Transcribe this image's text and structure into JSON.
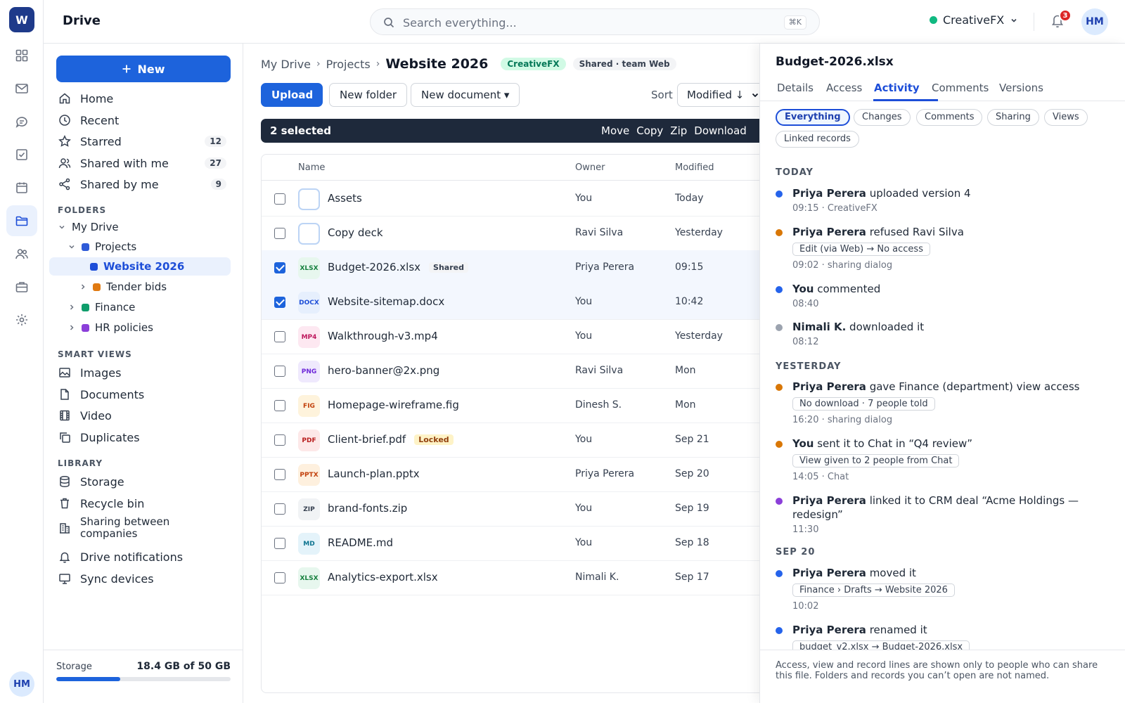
{
  "app": {
    "logo_letter": "W",
    "title": "Drive",
    "user_initials": "HM"
  },
  "search": {
    "placeholder": "Search everything...",
    "shortcut": "⌘K"
  },
  "header": {
    "company": "CreativeFX",
    "notification_count": "3",
    "avatar": "HM"
  },
  "rail": {
    "icons": [
      "grid-icon",
      "mail-icon",
      "chat-icon",
      "task-icon",
      "calendar-icon",
      "folder-icon",
      "people-icon",
      "briefcase-icon",
      "gear-icon"
    ],
    "active": "folder-icon"
  },
  "sidebar": {
    "new_label": "New",
    "nav": [
      {
        "label": "Home",
        "icon": "home-icon"
      },
      {
        "label": "Recent",
        "icon": "clock-icon"
      },
      {
        "label": "Starred",
        "icon": "star-icon",
        "count": "12"
      },
      {
        "label": "Shared with me",
        "icon": "people-icon",
        "count": "27"
      },
      {
        "label": "Shared by me",
        "icon": "share-icon",
        "count": "9"
      }
    ],
    "folders_label": "FOLDERS",
    "tree": [
      {
        "label": "My Drive"
      },
      {
        "label": "Projects",
        "color": "#2f5bd8"
      },
      {
        "label": "Website 2026",
        "color": "#1d4ed8"
      },
      {
        "label": "Tender bids",
        "color": "#e07a12"
      },
      {
        "label": "Finance",
        "color": "#0f9d6b"
      },
      {
        "label": "HR policies",
        "color": "#8b3fd9"
      }
    ],
    "smart_label": "SMART VIEWS",
    "smart": [
      {
        "label": "Images",
        "icon": "image-icon"
      },
      {
        "label": "Documents",
        "icon": "document-icon"
      },
      {
        "label": "Video",
        "icon": "film-icon"
      },
      {
        "label": "Duplicates",
        "icon": "copy-icon"
      }
    ],
    "library_label": "LIBRARY",
    "library": [
      {
        "label": "Storage",
        "icon": "database-icon"
      },
      {
        "label": "Recycle bin",
        "icon": "trash-icon"
      },
      {
        "label": "Sharing between",
        "label2": "companies",
        "icon": "building-icon"
      },
      {
        "label": "Drive notifications",
        "icon": "bell-icon"
      },
      {
        "label": "Sync devices",
        "icon": "monitor-icon"
      }
    ],
    "storage": {
      "label": "Storage",
      "value": "18.4 GB of 50 GB",
      "fraction": 0.368
    }
  },
  "main": {
    "breadcrumb": [
      "My Drive",
      "Projects"
    ],
    "current": "Website 2026",
    "company_pill": "CreativeFX",
    "shared_pill": "Shared · team Web",
    "upload": "Upload",
    "new_folder": "New folder",
    "new_document": "New document ▾",
    "sort_label": "Sort",
    "sort_value": "Modified ↓",
    "selection": {
      "count": "2 selected",
      "actions": [
        "Move",
        "Copy",
        "Zip",
        "Download"
      ]
    },
    "columns": {
      "name": "Name",
      "owner": "Owner",
      "modified": "Modified"
    },
    "files": [
      {
        "name": "Assets",
        "type": "folder",
        "owner": "You",
        "modified": "Today",
        "checked": false
      },
      {
        "name": "Copy deck",
        "type": "folder",
        "owner": "Ravi Silva",
        "modified": "Yesterday",
        "checked": false
      },
      {
        "name": "Budget-2026.xlsx",
        "type": "XLSX",
        "owner": "Priya Perera",
        "modified": "09:15",
        "checked": true,
        "tag": "Shared"
      },
      {
        "name": "Website-sitemap.docx",
        "type": "DOCX",
        "owner": "You",
        "modified": "10:42",
        "checked": true
      },
      {
        "name": "Walkthrough-v3.mp4",
        "type": "MP4",
        "owner": "You",
        "modified": "Yesterday",
        "checked": false
      },
      {
        "name": "hero-banner@2x.png",
        "type": "PNG",
        "owner": "Ravi Silva",
        "modified": "Mon",
        "checked": false
      },
      {
        "name": "Homepage-wireframe.fig",
        "type": "FIG",
        "owner": "Dinesh S.",
        "modified": "Mon",
        "checked": false
      },
      {
        "name": "Client-brief.pdf",
        "type": "PDF",
        "owner": "You",
        "modified": "Sep 21",
        "checked": false,
        "tag": "Locked"
      },
      {
        "name": "Launch-plan.pptx",
        "type": "PPTX",
        "owner": "Priya Perera",
        "modified": "Sep 20",
        "checked": false
      },
      {
        "name": "brand-fonts.zip",
        "type": "ZIP",
        "owner": "You",
        "modified": "Sep 19",
        "checked": false
      },
      {
        "name": "README.md",
        "type": "MD",
        "owner": "You",
        "modified": "Sep 18",
        "checked": false
      },
      {
        "name": "Analytics-export.xlsx",
        "type": "XLSX",
        "owner": "Nimali K.",
        "modified": "Sep 17",
        "checked": false
      }
    ]
  },
  "panel": {
    "title": "Budget-2026.xlsx",
    "tabs": [
      "Details",
      "Access",
      "Activity",
      "Comments",
      "Versions"
    ],
    "active_tab": "Activity",
    "filters": [
      "Everything",
      "Changes",
      "Comments",
      "Sharing",
      "Views",
      "Linked records"
    ],
    "active_filter": "Everything",
    "days": {
      "today": "TODAY",
      "yesterday": "YESTERDAY",
      "sep20": "SEP 20"
    },
    "events": [
      {
        "actor": "Priya Perera",
        "text": " uploaded version 4",
        "meta": "09:15 · CreativeFX",
        "color": "#2563eb"
      },
      {
        "actor": "Priya Perera",
        "text": " refused Ravi Silva",
        "chip": "Edit (via Web) → No access",
        "meta": "09:02 · sharing dialog",
        "color": "#d97706"
      },
      {
        "actor": "You",
        "text": " commented",
        "meta": "08:40",
        "color": "#2563eb"
      },
      {
        "actor": "Nimali K.",
        "text": " downloaded it",
        "meta": "08:12",
        "color": "#9ca3af"
      },
      {
        "actor": "Priya Perera",
        "text": " gave Finance (department) view access",
        "chip": "No download · 7 people told",
        "meta": "16:20 · sharing dialog",
        "color": "#d97706"
      },
      {
        "actor": "You",
        "text": " sent it to Chat in “Q4 review”",
        "chip": "View given to 2 people from Chat",
        "meta": "14:05 · Chat",
        "color": "#d97706"
      },
      {
        "actor": "Priya Perera",
        "text": " linked it to CRM deal “Acme Holdings — redesign”",
        "meta": "11:30",
        "color": "#8b3fd9"
      },
      {
        "actor": "Priya Perera",
        "text": " moved it",
        "chip": "Finance › Drafts → Website 2026",
        "meta": "10:02",
        "color": "#2563eb"
      },
      {
        "actor": "Priya Perera",
        "text": " renamed it",
        "chip": "budget_v2.xlsx → Budget-2026.xlsx",
        "meta": "",
        "color": "#2563eb"
      }
    ],
    "footer": "Access, view and record lines are shown only to people who can share this file. Folders and records you can’t open are not named."
  }
}
